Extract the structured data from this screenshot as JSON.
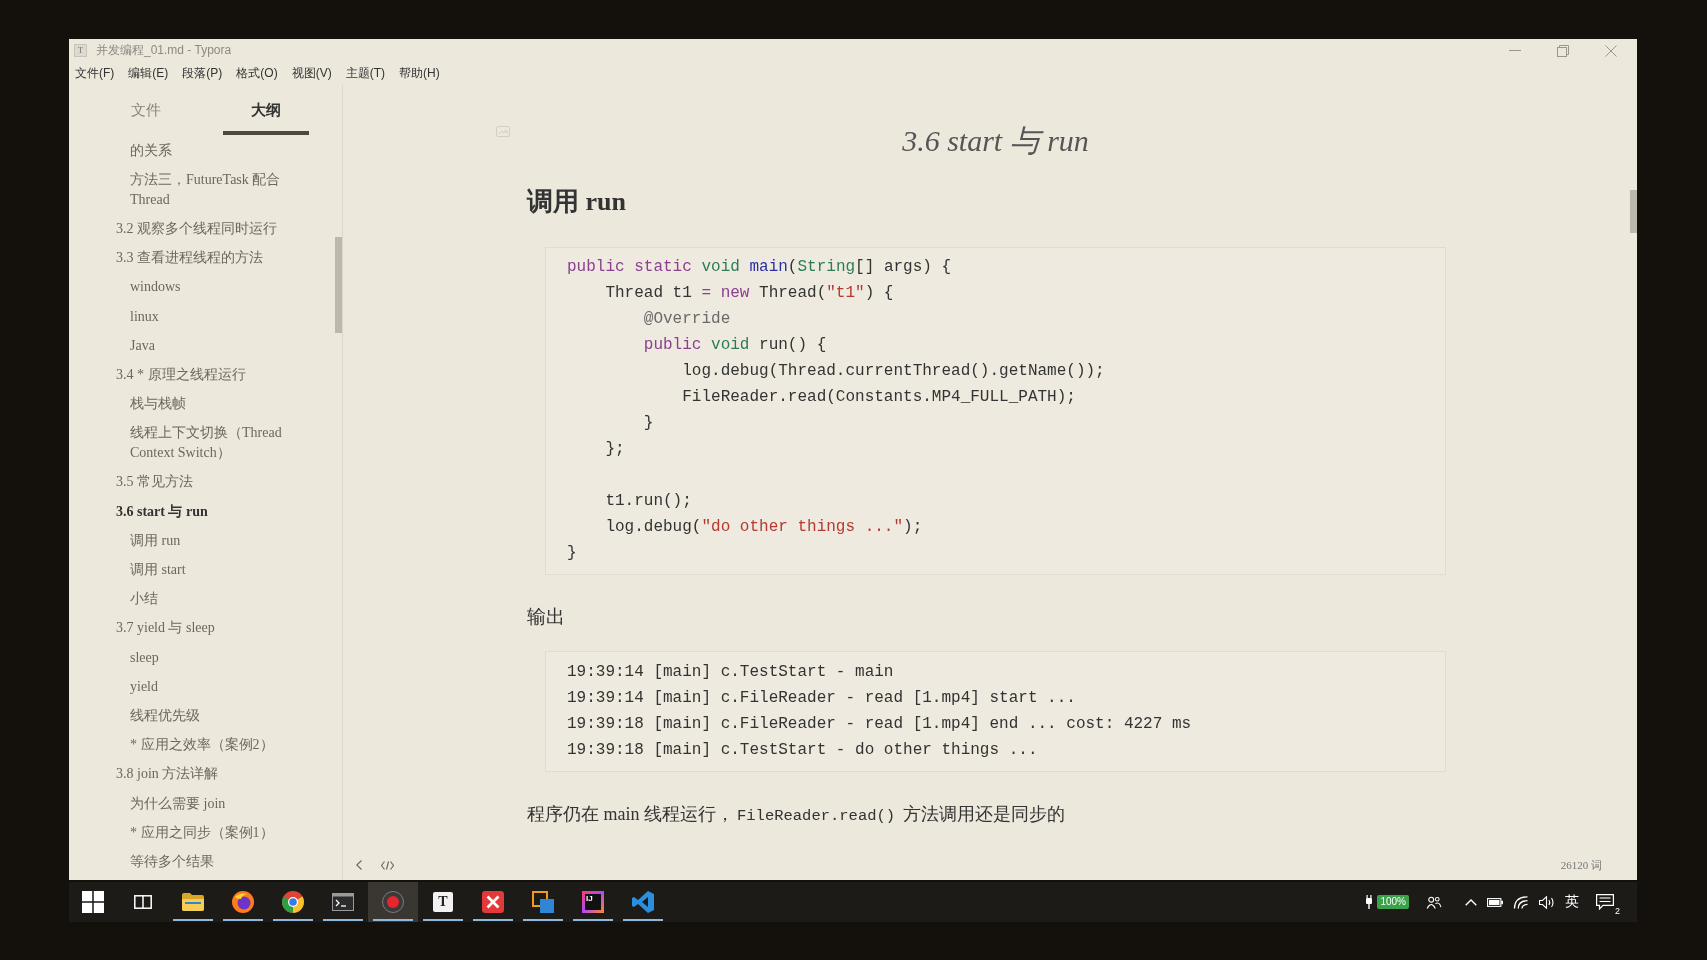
{
  "window": {
    "app_icon": "T",
    "title": "并发编程_01.md - Typora"
  },
  "menu": [
    "文件(F)",
    "编辑(E)",
    "段落(P)",
    "格式(O)",
    "视图(V)",
    "主题(T)",
    "帮助(H)"
  ],
  "sidebar": {
    "tabs": [
      {
        "label": "文件",
        "selected": false
      },
      {
        "label": "大纲",
        "selected": true
      }
    ],
    "outline": [
      {
        "children": [
          {
            "label": "的关系",
            "selected": false
          },
          {
            "label": "方法三，FutureTask 配合 Thread",
            "selected": false
          }
        ]
      },
      {
        "label": "3.2 观察多个线程同时运行",
        "selected": false
      },
      {
        "label": "3.3 查看进程线程的方法",
        "selected": false,
        "children": [
          {
            "label": "windows",
            "selected": false
          },
          {
            "label": "linux",
            "selected": false
          },
          {
            "label": "Java",
            "selected": false
          }
        ]
      },
      {
        "label": "3.4 * 原理之线程运行",
        "selected": false,
        "children": [
          {
            "label": "栈与栈帧",
            "selected": false
          },
          {
            "label": "线程上下文切换（Thread Context Switch）",
            "selected": false
          }
        ]
      },
      {
        "label": "3.5 常见方法",
        "selected": false
      },
      {
        "label": "3.6 start 与 run",
        "selected": true,
        "children": [
          {
            "label": "调用 run",
            "selected": false
          },
          {
            "label": "调用 start",
            "selected": false
          },
          {
            "label": "小结",
            "selected": false
          }
        ]
      },
      {
        "label": "3.7 yield 与 sleep",
        "selected": false,
        "children": [
          {
            "label": "sleep",
            "selected": false
          },
          {
            "label": "yield",
            "selected": false
          },
          {
            "label": "线程优先级",
            "selected": false
          },
          {
            "label": "* 应用之效率（案例2）",
            "selected": false
          }
        ]
      },
      {
        "label": "3.8 join 方法详解",
        "selected": false,
        "children": [
          {
            "label": "为什么需要 join",
            "selected": false
          },
          {
            "label": "* 应用之同步（案例1）",
            "selected": false
          },
          {
            "label": "等待多个结果",
            "selected": false
          }
        ]
      }
    ]
  },
  "editor": {
    "title": "3.6 start 与 run",
    "heading": "调用 run",
    "code": [
      {
        "kind": "code",
        "tokens": [
          {
            "text": "public static",
            "kind": "keyword"
          },
          {
            "text": " void",
            "kind": "type"
          },
          {
            "text": " main",
            "kind": "name"
          },
          {
            "text": "(",
            "kind": "plain"
          },
          {
            "text": "String",
            "kind": "type"
          },
          {
            "text": "[] args) {",
            "kind": "plain"
          }
        ]
      },
      {
        "kind": "code",
        "tokens": [
          {
            "text": "    Thread t1 ",
            "kind": "plain"
          },
          {
            "text": "= new",
            "kind": "keyword"
          },
          {
            "text": " Thread(",
            "kind": "plain"
          },
          {
            "text": "\"t1\"",
            "kind": "string"
          },
          {
            "text": ") {",
            "kind": "plain"
          }
        ]
      },
      {
        "kind": "code",
        "tokens": [
          {
            "text": "        @Override",
            "kind": "annotation"
          }
        ]
      },
      {
        "kind": "code",
        "tokens": [
          {
            "text": "        public",
            "kind": "keyword"
          },
          {
            "text": " void",
            "kind": "type"
          },
          {
            "text": " run() {",
            "kind": "plain"
          }
        ]
      },
      {
        "kind": "code",
        "tokens": [
          {
            "text": "            log.debug(Thread.currentThread().getName());",
            "kind": "plain"
          }
        ]
      },
      {
        "kind": "code",
        "tokens": [
          {
            "text": "            FileReader.read(Constants.MP4_FULL_PATH);",
            "kind": "plain"
          }
        ]
      },
      {
        "kind": "code",
        "tokens": [
          {
            "text": "        }",
            "kind": "plain"
          }
        ]
      },
      {
        "kind": "code",
        "tokens": [
          {
            "text": "    };",
            "kind": "plain"
          }
        ]
      },
      {
        "kind": "blank"
      },
      {
        "kind": "code",
        "tokens": [
          {
            "text": "    t1.run();",
            "kind": "plain"
          }
        ]
      },
      {
        "kind": "code",
        "tokens": [
          {
            "text": "    log.debug(",
            "kind": "plain"
          },
          {
            "text": "\"do other things ...\"",
            "kind": "string"
          },
          {
            "text": ");",
            "kind": "plain"
          }
        ]
      },
      {
        "kind": "code",
        "tokens": [
          {
            "text": "}",
            "kind": "plain"
          }
        ]
      }
    ],
    "output_heading": "输出",
    "output": [
      "19:39:14 [main] c.TestStart - main",
      "19:39:14 [main] c.FileReader - read [1.mp4] start ...",
      "19:39:18 [main] c.FileReader - read [1.mp4] end ... cost: 4227 ms",
      "19:39:18 [main] c.TestStart - do other things ..."
    ],
    "paragraph": [
      {
        "kind": "text",
        "text": "程序仍在 main 线程运行，"
      },
      {
        "kind": "code",
        "text": "FileReader.read()"
      },
      {
        "kind": "text",
        "text": " 方法调用还是同步的"
      }
    ]
  },
  "status_bar": {
    "word_count": "26120 词"
  },
  "taskbar": {
    "apps": [
      {
        "kind": "start",
        "active": false,
        "selected": false
      },
      {
        "kind": "task_view",
        "active": false,
        "selected": false
      },
      {
        "kind": "folder",
        "active": true,
        "selected": false
      },
      {
        "kind": "fox_browser",
        "active": true,
        "selected": false
      },
      {
        "kind": "round_browser",
        "active": true,
        "selected": false
      },
      {
        "kind": "terminal",
        "active": true,
        "selected": false
      },
      {
        "kind": "recorder",
        "active": true,
        "selected": true
      },
      {
        "kind": "letter_tile",
        "glyph": "T",
        "active": true,
        "selected": false
      },
      {
        "kind": "x_tile",
        "active": true,
        "selected": false
      },
      {
        "kind": "squares",
        "active": true,
        "selected": false
      },
      {
        "kind": "gradient_tile",
        "glyph": "IJ",
        "active": true,
        "selected": false
      },
      {
        "kind": "ribbon",
        "active": true,
        "selected": false
      }
    ],
    "tray": {
      "battery": "100%",
      "input_method": "英",
      "notifications": "2"
    }
  }
}
